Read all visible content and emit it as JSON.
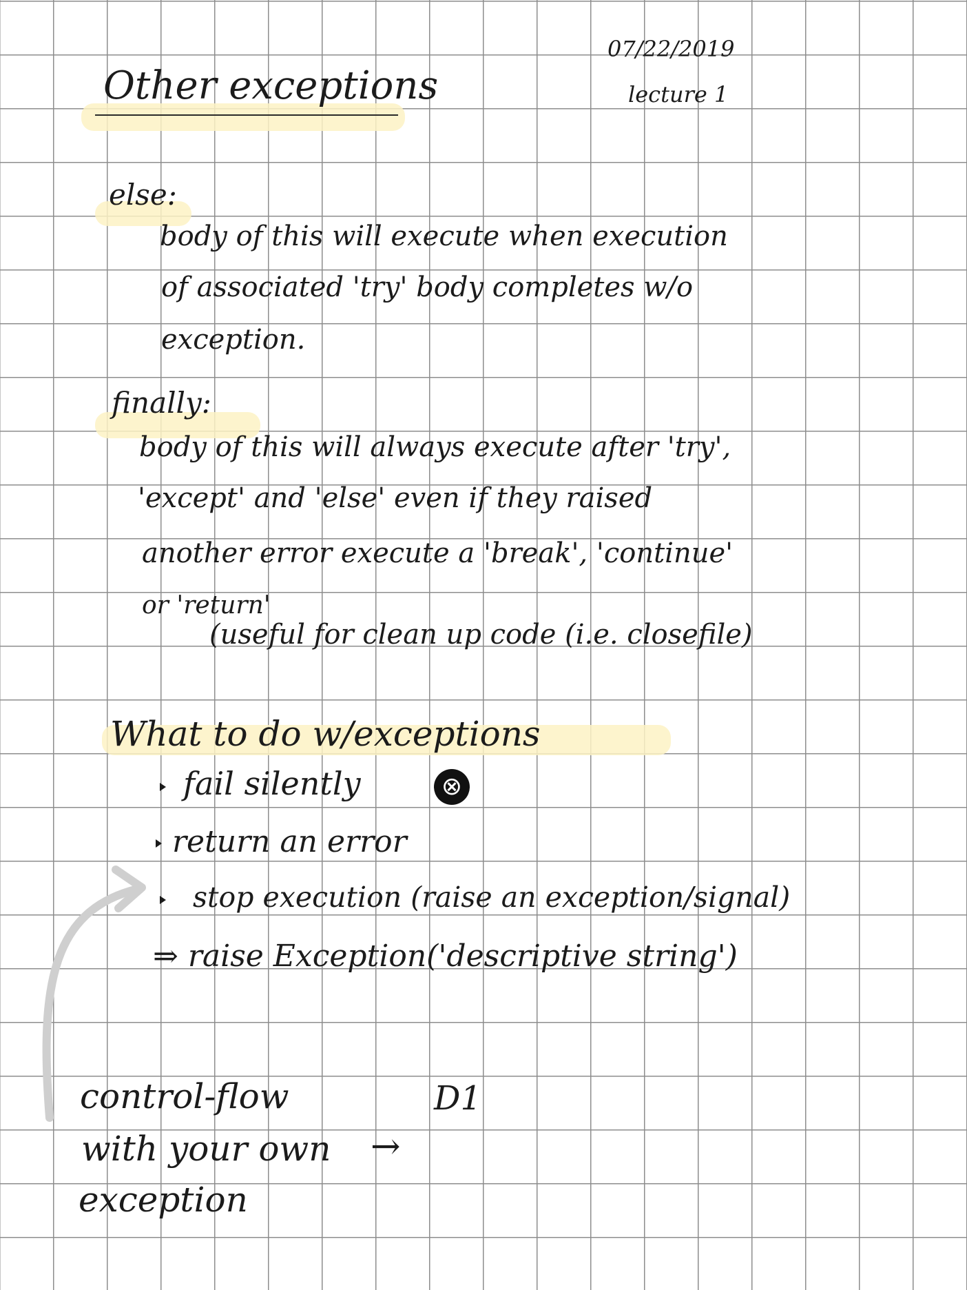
{
  "header": {
    "date": "07/22/2019",
    "lecture": "lecture 1",
    "title": "Other exceptions"
  },
  "else_section": {
    "keyword": "else:",
    "lines": [
      "body of this will execute when execution",
      "of associated 'try' body completes w/o",
      "exception."
    ]
  },
  "finally_section": {
    "keyword": "finally:",
    "lines": [
      "body of this will always execute after 'try',",
      "'except' and 'else' even if they raised",
      "another error execute a 'break', 'continue'",
      "or 'return'"
    ],
    "note": "(useful for clean up code (i.e. closefile)"
  },
  "exceptions_section": {
    "heading": "What to do w/exceptions",
    "bullets": [
      "fail silently",
      "return an error",
      "stop execution (raise an exception/signal)"
    ],
    "bad_mark": "⊗",
    "raise_line": "⇒ raise Exception('descriptive string')"
  },
  "bottom_note": {
    "lines": [
      "control-flow",
      "with your own",
      "exception"
    ],
    "arrow": "→",
    "target": "D1"
  },
  "colors": {
    "ink": "#1b1b1b",
    "grid": "#8d8d8d",
    "highlight": "#fdf2c4",
    "curved_arrow": "#cfcfcf"
  }
}
